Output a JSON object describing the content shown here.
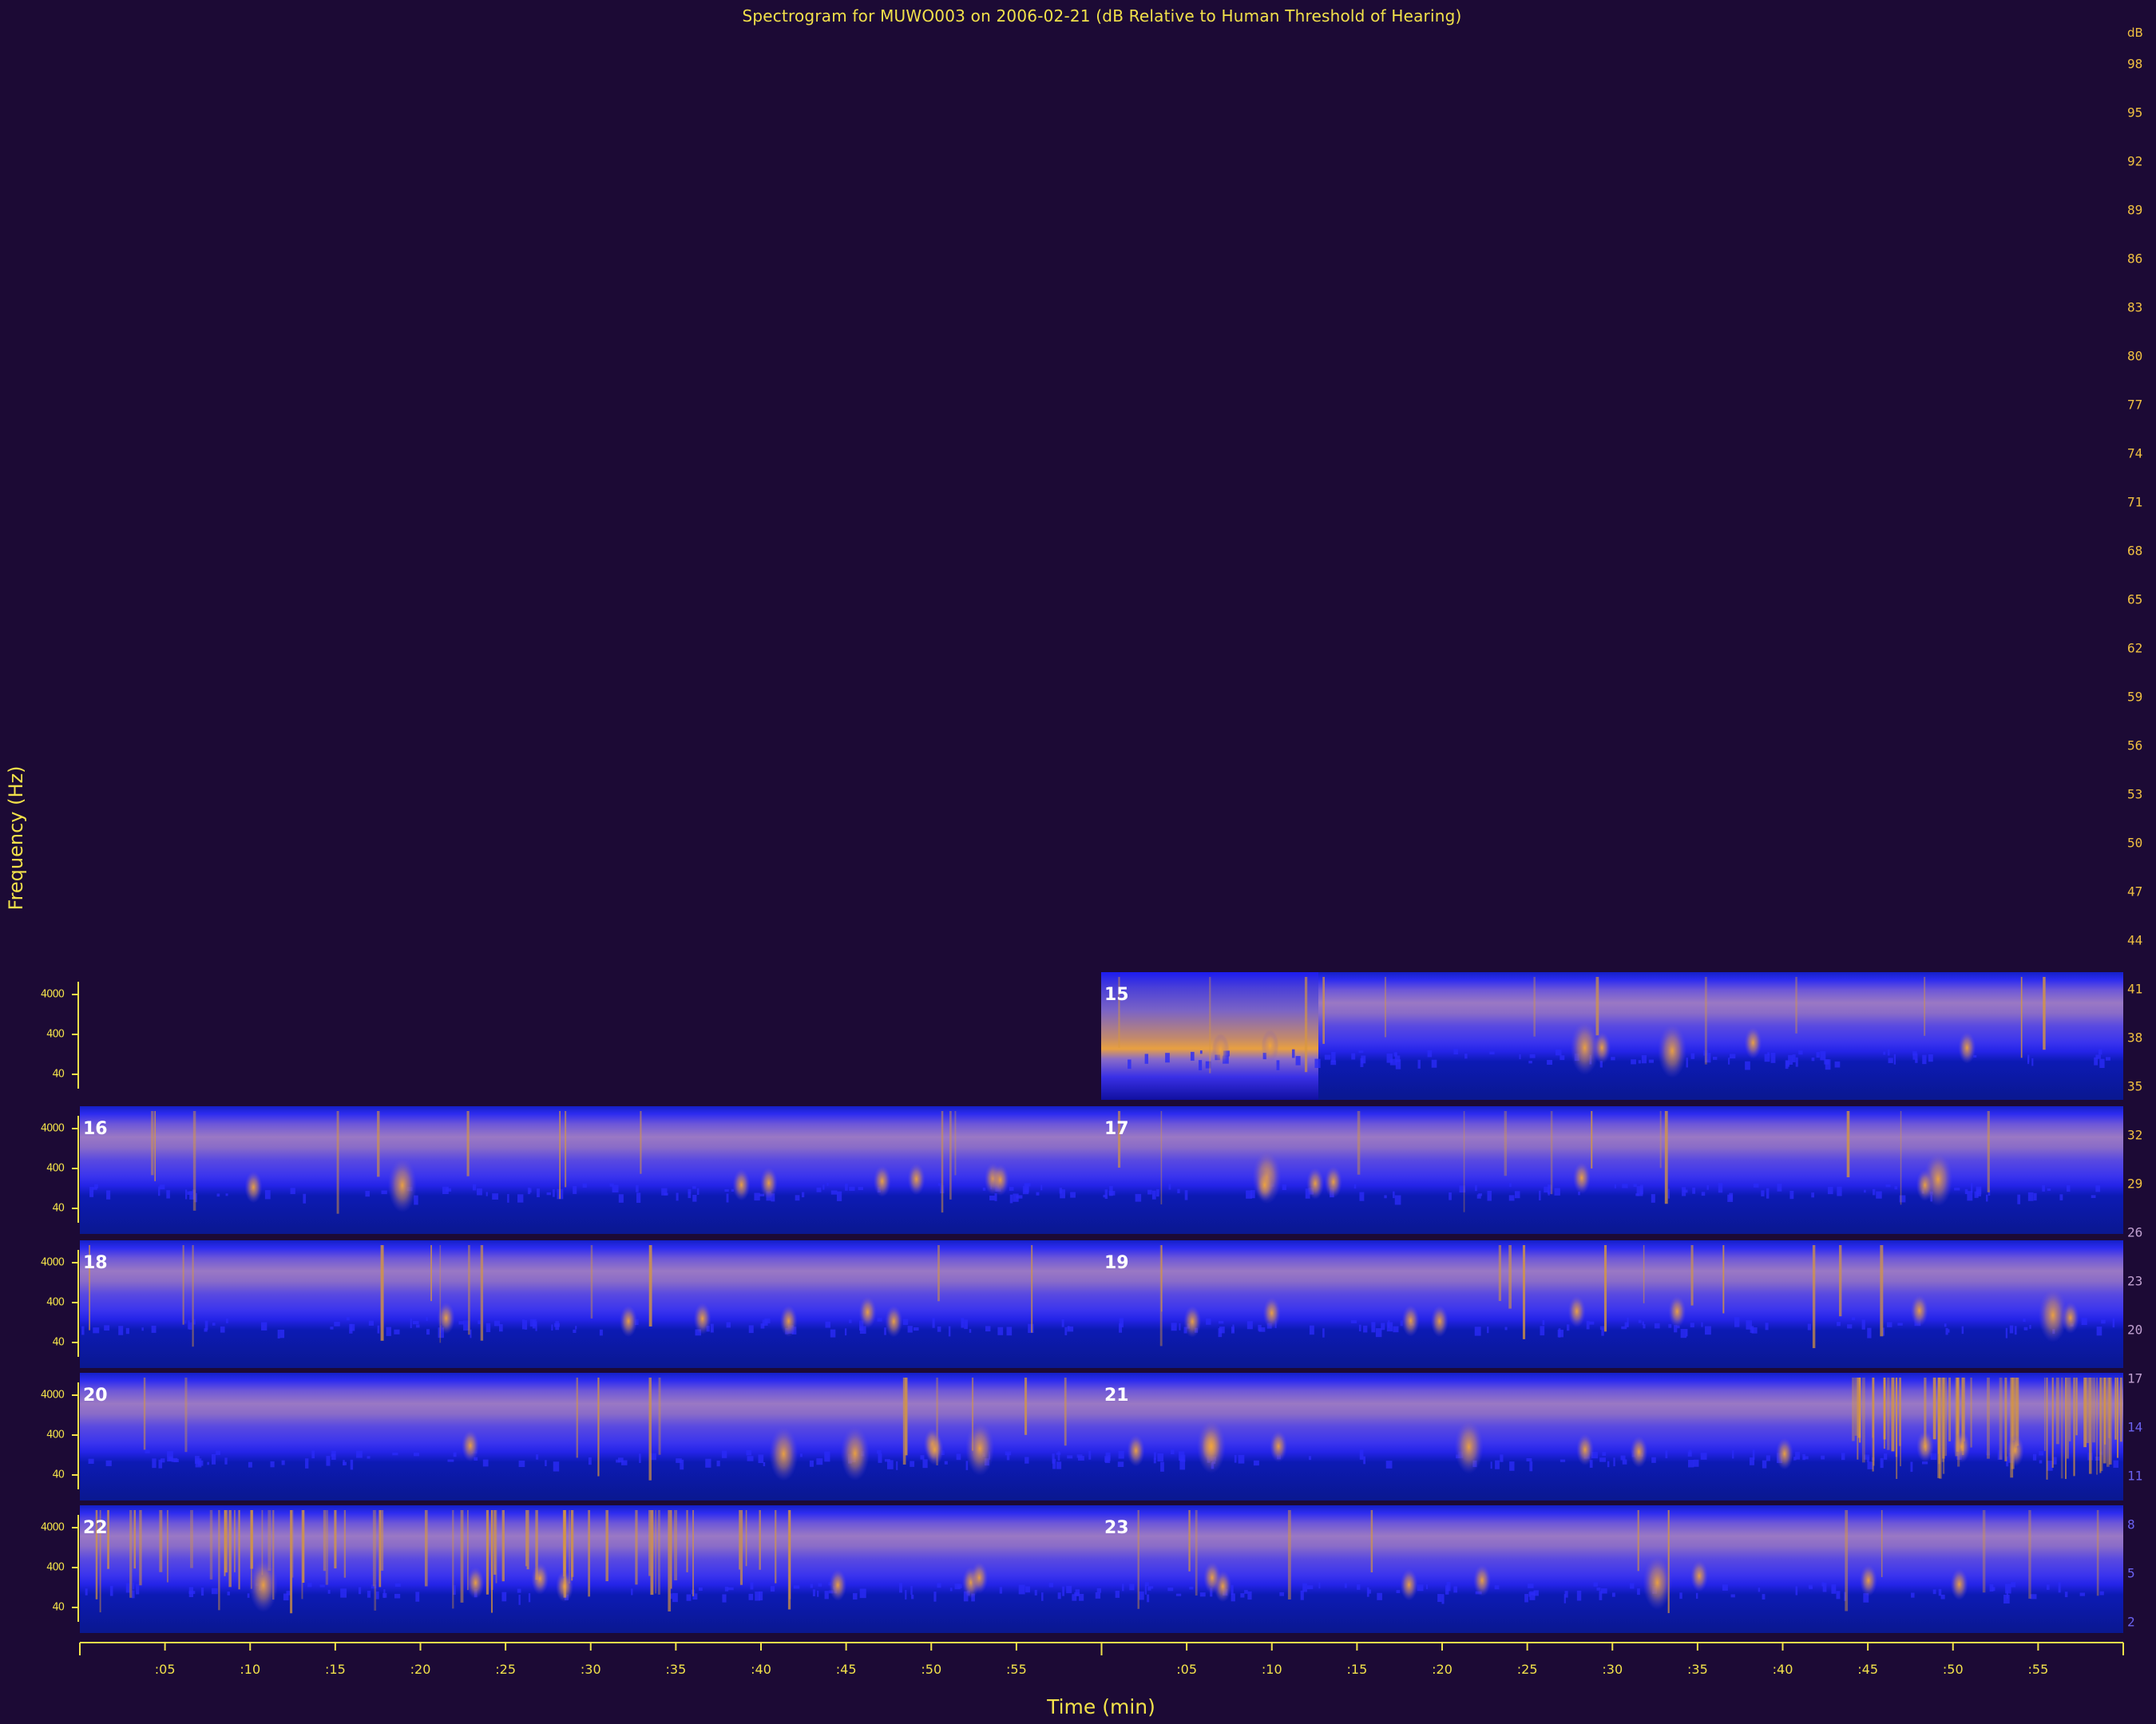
{
  "chart_data": {
    "type": "heatmap",
    "title": "Spectrogram for MUWO003 on 2006-02-21 (dB Relative to Human Threshold of Hearing)",
    "xlabel": "Time (min)",
    "ylabel": "Frequency (Hz)",
    "colorbar": {
      "unit": "dB",
      "ticks": [
        98,
        95,
        92,
        89,
        86,
        83,
        80,
        77,
        74,
        71,
        68,
        65,
        62,
        59,
        56,
        53,
        50,
        47,
        44,
        41,
        38,
        35,
        32,
        29,
        26,
        23,
        20,
        17,
        14,
        11,
        8,
        5,
        2
      ]
    },
    "y_ticks": [
      "4000",
      "400",
      "40"
    ],
    "x_ticks": [
      ":05",
      ":10",
      ":15",
      ":20",
      ":25",
      ":30",
      ":35",
      ":40",
      ":45",
      ":50",
      ":55",
      ":05",
      ":10",
      ":15",
      ":20",
      ":25",
      ":30",
      ":35",
      ":40",
      ":45",
      ":50",
      ":55"
    ],
    "panels": [
      {
        "label": "15",
        "row": 0,
        "column": 1
      },
      {
        "label": "16",
        "row": 1,
        "column": 0
      },
      {
        "label": "17",
        "row": 1,
        "column": 1
      },
      {
        "label": "18",
        "row": 2,
        "column": 0
      },
      {
        "label": "19",
        "row": 2,
        "column": 1
      },
      {
        "label": "20",
        "row": 3,
        "column": 0
      },
      {
        "label": "21",
        "row": 3,
        "column": 1
      },
      {
        "label": "22",
        "row": 4,
        "column": 0
      },
      {
        "label": "23",
        "row": 4,
        "column": 1
      }
    ],
    "colors": {
      "background": "#1c0a35",
      "text": "#f2e14a",
      "low": "#0a1a9a",
      "mid": "#3a35ee",
      "high": "#f0a030"
    }
  }
}
